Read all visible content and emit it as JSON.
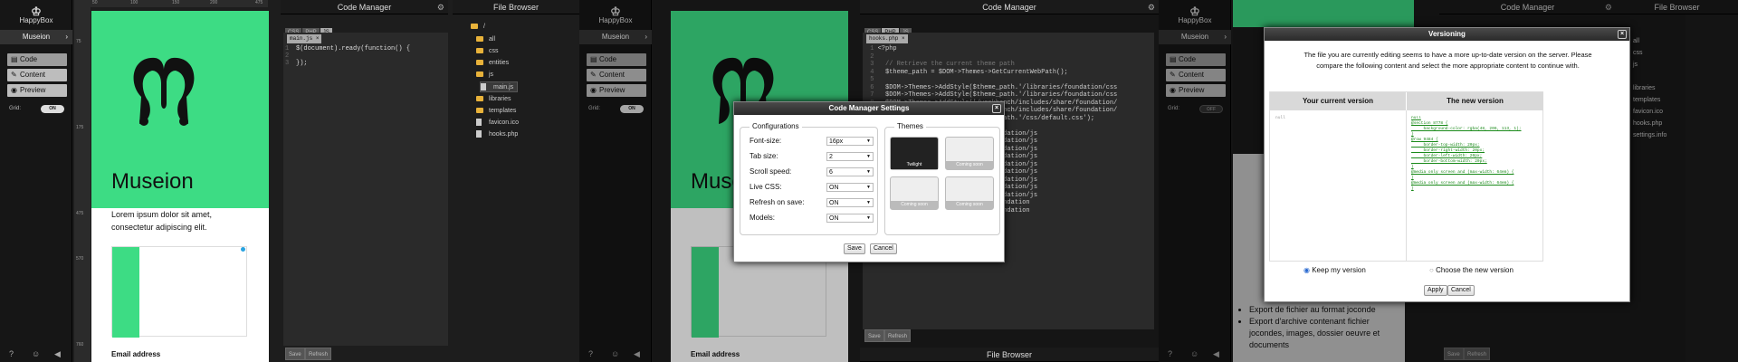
{
  "app": {
    "logo_text": "HappyBox",
    "project": "Museion",
    "menu": [
      "Code",
      "Content",
      "Preview"
    ],
    "grid_label": "Grid:",
    "grid_on": "ON",
    "grid_off": "OFF"
  },
  "ruler": {
    "top": [
      "50",
      "100",
      "150",
      "200",
      "250",
      "300",
      "350",
      "400",
      "475"
    ],
    "left": [
      "75",
      "175",
      "275",
      "375",
      "475",
      "570",
      "675",
      "760"
    ]
  },
  "preview": {
    "title": "Museion",
    "lorem": "Lorem ipsum dolor sit amet, consectetur adipiscing elit.",
    "email_label": "Email address"
  },
  "code_manager": {
    "title": "Code Manager",
    "tabs": [
      "CSS",
      "PHP",
      "JS"
    ],
    "file_tab_1": "main.js",
    "file_tab_2": "hooks.php",
    "code_js_1": "$(document).ready(function() {",
    "code_js_2": "",
    "code_js_3": "});",
    "save_label": "Save",
    "refresh_label": "Refresh"
  },
  "php_code": [
    "<?php",
    "",
    "  // Retrieve the current theme path",
    "  $theme_path = $DOM->Themes->GetCurrentWebPath();",
    "",
    "  $DOM->Themes->AddStyle($theme_path.'/libraries/foundation/css",
    "  $DOM->Themes->AddStyle($theme_path.'/libraries/foundation/css",
    "  $DOM->Themes->AddStyle('/workbench/includes/share/foundation/",
    "  $DOM->Themes->AddStyle('/workbench/includes/share/foundation/",
    "  $DOM->Themes->AddStyle($theme_path.'/css/default.css');",
    "",
    "  ...$theme_path.'/libraries/foundation/js",
    "  ...$theme_path.'/libraries/foundation/js",
    "  ...$theme_path.'/libraries/foundation/js",
    "  ...$theme_path.'/libraries/foundation/js",
    "  ...$theme_path.'/libraries/foundation/js",
    "  ...$theme_path.'/libraries/foundation/js",
    "  ...$theme_path.'/libraries/foundation/js",
    "  ...$theme_path.'/libraries/foundation/js",
    "  ...$theme_path.'/libraries/foundation/js",
    "  ...workbench/includes/share/foundation",
    "  ...workbench/includes/share/foundation",
    "  ...$theme_path.'/js/main.js');"
  ],
  "file_browser": {
    "title": "File Browser",
    "root": "/",
    "items": [
      "all",
      "css",
      "entities",
      "js",
      "main.js",
      "libraries",
      "templates",
      "favicon.ico",
      "hooks.php"
    ],
    "items_short": [
      "all",
      "css",
      "js",
      "libraries",
      "templates",
      "favicon.ico",
      "hooks.php",
      "settings.info"
    ]
  },
  "settings_dialog": {
    "title": "Code Manager Settings",
    "configurations_legend": "Configurations",
    "themes_legend": "Themes",
    "rows": [
      {
        "label": "Font-size:",
        "value": "16px"
      },
      {
        "label": "Tab size:",
        "value": "2"
      },
      {
        "label": "Scroll speed:",
        "value": "6"
      },
      {
        "label": "Live CSS:",
        "value": "ON"
      },
      {
        "label": "Refresh on save:",
        "value": "ON"
      },
      {
        "label": "Models:",
        "value": "ON"
      }
    ],
    "themes": [
      "Twilight",
      "Coming soon",
      "Coming soon",
      "Coming soon"
    ],
    "save": "Save",
    "cancel": "Cancel"
  },
  "versioning_dialog": {
    "title": "Versioning",
    "message": "The file you are currently editing seems to have a more up-to-date version on the server. Please compare the following content and select the more appropriate content to continue with.",
    "col_current": "Your current version",
    "col_new": "The new version",
    "current_content": "null",
    "new_content": "null\n@section 8778 {\n     background-color: rgba(48, 206, 113, 1);\n}\n@row 9484 {\n     border-top-width: 20px;\n     border-right-width: 20px;\n     border-left-width: 20px;\n     border-bottom-width: 20px;\n}\n@media only screen and (max-width: 64em) {\n}\n@media only screen and (max-width: 64em) {\n}",
    "keep": "Keep my version",
    "choose": "Choose the new version",
    "apply": "Apply",
    "cancel": "Cancel"
  },
  "bg_content": {
    "bullets": [
      "Export de fichier au format joconde",
      "Export d'archive contenant fichier jocondes, images, dossier oeuvre et documents"
    ]
  }
}
